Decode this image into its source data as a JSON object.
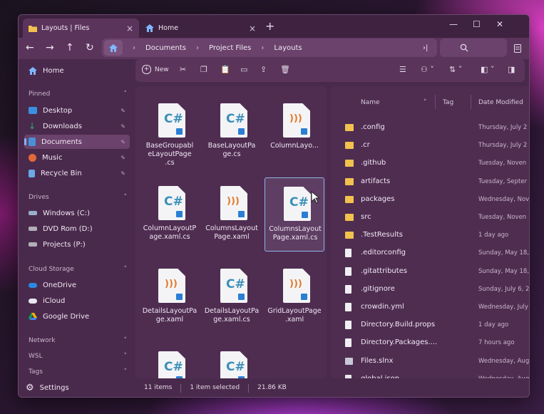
{
  "window": {
    "tabs": [
      {
        "label": "Layouts | Files",
        "icon": "folder-icon",
        "active": true
      },
      {
        "label": "Home",
        "icon": "home-icon",
        "active": false
      }
    ]
  },
  "breadcrumb": [
    "Documents",
    "Project Files",
    "Layouts"
  ],
  "toolbar": {
    "new_label": "New"
  },
  "sidebar": {
    "home": "Home",
    "pinned_header": "Pinned",
    "pinned": [
      {
        "label": "Desktop",
        "color": "#3a8fe0"
      },
      {
        "label": "Downloads",
        "color": "#30b070"
      },
      {
        "label": "Documents",
        "color": "#4a90d9"
      },
      {
        "label": "Music",
        "color": "#e06a3a"
      },
      {
        "label": "Recycle Bin",
        "color": "#6aa8e8"
      }
    ],
    "drives_header": "Drives",
    "drives": [
      {
        "label": "Windows (C:)",
        "color": "#9ab0c8"
      },
      {
        "label": "DVD Rom (D:)",
        "color": "#b0b0b8"
      },
      {
        "label": "Projects (P:)",
        "color": "#b0b0b8"
      }
    ],
    "cloud_header": "Cloud Storage",
    "cloud": [
      {
        "label": "OneDrive",
        "color": "#2a8ae0"
      },
      {
        "label": "iCloud",
        "color": "#e8e8f0"
      },
      {
        "label": "Google Drive",
        "color": "#3aa860"
      }
    ],
    "network_header": "Network",
    "wsl_header": "WSL",
    "tags_header": "Tags",
    "settings": "Settings"
  },
  "grid": [
    {
      "name": "BaseGroupableLayoutPage.cs",
      "kind": "cs"
    },
    {
      "name": "BaseLayoutPage.cs",
      "kind": "cs"
    },
    {
      "name": "ColumnLayo...",
      "kind": "xaml"
    },
    {
      "name": "ColumnLayoutPage.xaml.cs",
      "kind": "cs"
    },
    {
      "name": "ColumnsLayoutPage.xaml",
      "kind": "xaml"
    },
    {
      "name": "ColumnsLayoutPage.xaml.cs",
      "kind": "cs",
      "selected": true
    },
    {
      "name": "DetailsLayoutPage.xaml",
      "kind": "xaml"
    },
    {
      "name": "DetailsLayoutPage.xaml.cs",
      "kind": "cs"
    },
    {
      "name": "GridLayoutPage.xaml",
      "kind": "xaml"
    },
    {
      "name": "",
      "kind": "cs"
    },
    {
      "name": "",
      "kind": "cs"
    }
  ],
  "grid_labels_wrapped": [
    [
      "BaseGroupabl",
      "eLayoutPage",
      ".cs"
    ],
    [
      "BaseLayoutPa",
      "ge.cs"
    ],
    [
      "ColumnLayo..."
    ],
    [
      "ColumnLayoutP",
      "age.xaml.cs"
    ],
    [
      "ColumnsLayout",
      "Page.xaml"
    ],
    [
      "ColumnsLayout",
      "Page.xaml.cs"
    ],
    [
      "DetailsLayoutPa",
      "ge.xaml"
    ],
    [
      "DetailsLayoutPa",
      "ge.xaml.cs"
    ],
    [
      "GridLayoutPage",
      ".xaml"
    ],
    [],
    []
  ],
  "details": {
    "columns": {
      "name": "Name",
      "tag": "Tag",
      "date": "Date Modified"
    },
    "rows": [
      {
        "name": ".config",
        "date": "Thursday, July 2",
        "kind": "folder"
      },
      {
        "name": ".cr",
        "date": "Thursday, July 2",
        "kind": "folder"
      },
      {
        "name": ".github",
        "date": "Tuesday, Noven",
        "kind": "folder"
      },
      {
        "name": "artifacts",
        "date": "Tuesday, Septer",
        "kind": "folder"
      },
      {
        "name": "packages",
        "date": "Wednesday, Nov",
        "kind": "folder"
      },
      {
        "name": "src",
        "date": "Tuesday, Noven",
        "kind": "folder"
      },
      {
        "name": ".TestResults",
        "date": "1 day ago",
        "kind": "folder"
      },
      {
        "name": ".editorconfig",
        "date": "Sunday, May 18,",
        "kind": "file"
      },
      {
        "name": ".gitattributes",
        "date": "Sunday, May 18,",
        "kind": "file"
      },
      {
        "name": ".gitignore",
        "date": "Sunday, July 6, 2",
        "kind": "file"
      },
      {
        "name": "crowdin.yml",
        "date": "Wednesday, July",
        "kind": "file"
      },
      {
        "name": "Directory.Build.props",
        "date": "1 day ago",
        "kind": "file"
      },
      {
        "name": "Directory.Packages....",
        "date": "7 hours ago",
        "kind": "file"
      },
      {
        "name": "Files.slnx",
        "date": "Wednesday, Aug",
        "kind": "sln"
      },
      {
        "name": "global.json",
        "date": "Wednesday, Aug",
        "kind": "json"
      }
    ]
  },
  "status": {
    "items": "11 items",
    "selected": "1 item selected",
    "size": "21.86 KB"
  },
  "colors": {
    "folder": "#f2c14e",
    "cs_glyph": "#3a8fb8",
    "rss_glyph": "#e07a2a",
    "selection": "#8fb4e8"
  }
}
